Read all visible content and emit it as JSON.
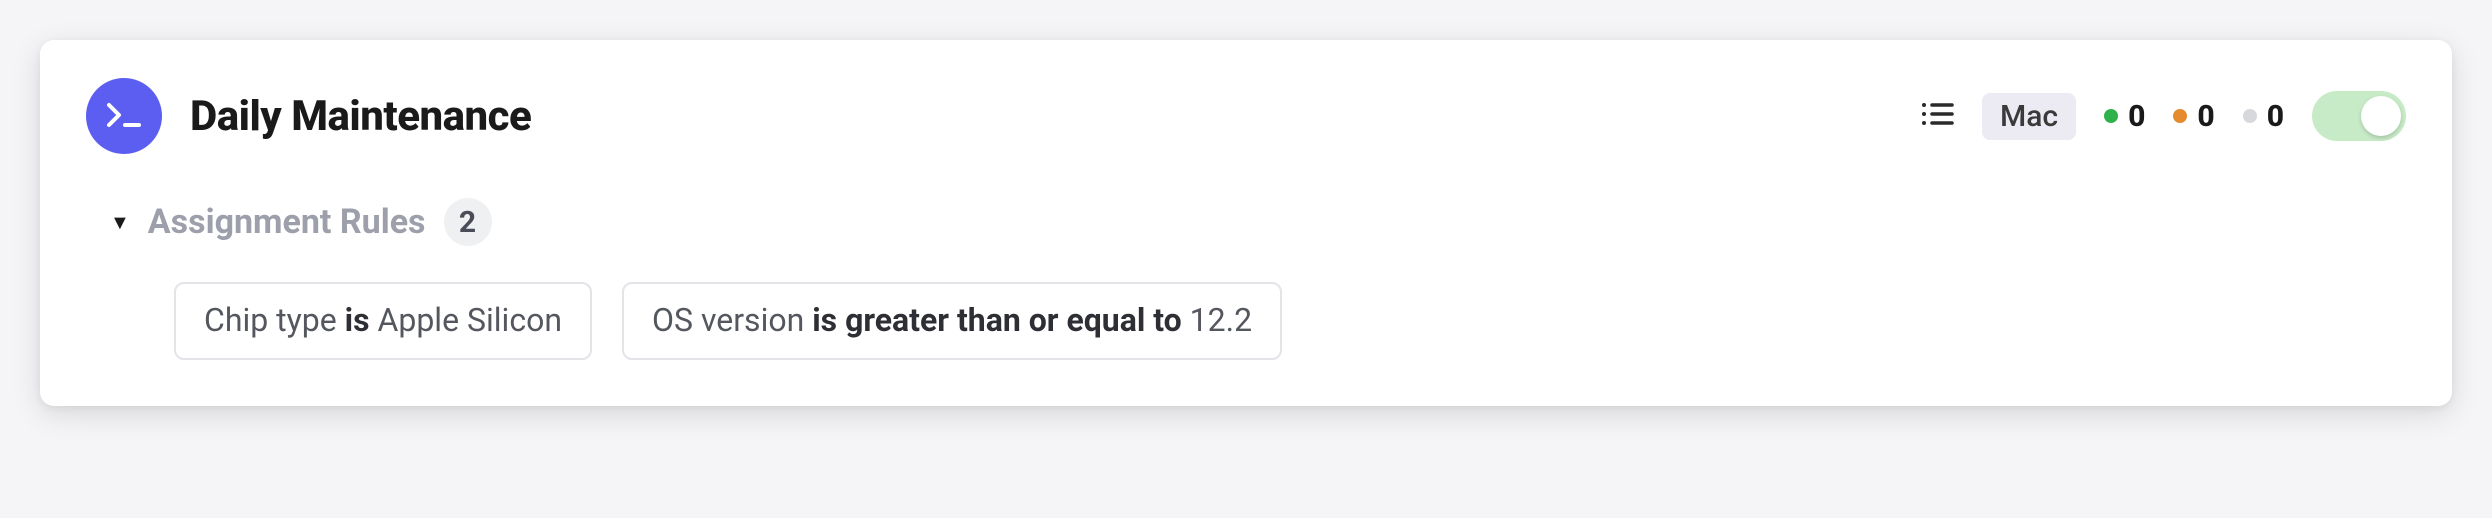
{
  "header": {
    "title": "Daily Maintenance",
    "platform": "Mac",
    "statuses": [
      {
        "color": "#2fb24c",
        "count": 0
      },
      {
        "color": "#e58a2f",
        "count": 0
      },
      {
        "color": "#d7d8dc",
        "count": 0
      }
    ],
    "toggle_on": true
  },
  "section": {
    "title": "Assignment Rules",
    "count": 2
  },
  "rules": [
    {
      "field": "Chip type",
      "op": "is",
      "value": "Apple Silicon"
    },
    {
      "field": "OS version",
      "op": "is greater than or equal to",
      "value": "12.2"
    }
  ]
}
